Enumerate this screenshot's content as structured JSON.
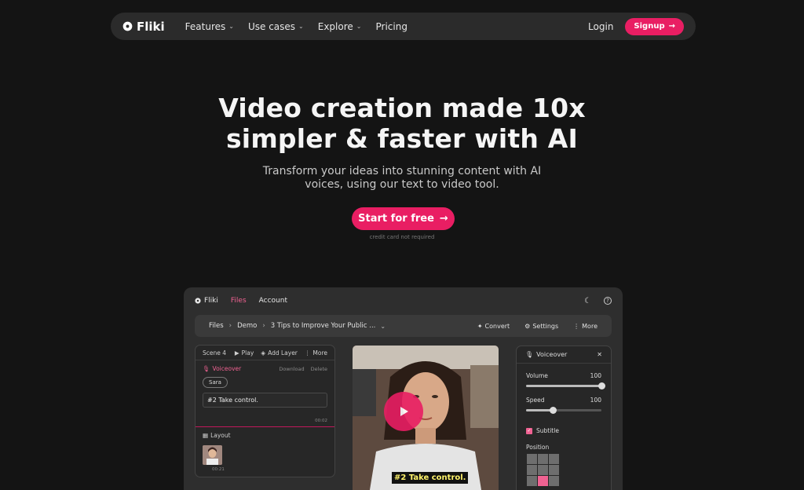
{
  "nav": {
    "brand": "Fliki",
    "items": [
      {
        "label": "Features",
        "has_menu": true
      },
      {
        "label": "Use cases",
        "has_menu": true
      },
      {
        "label": "Explore",
        "has_menu": true
      },
      {
        "label": "Pricing",
        "has_menu": false
      }
    ],
    "login": "Login",
    "signup": "Signup"
  },
  "hero": {
    "title_line1": "Video creation made 10x",
    "title_line2": "simpler & faster with AI",
    "subtitle_line1": "Transform your ideas into stunning content with AI",
    "subtitle_line2": "voices, using our text to video tool.",
    "cta": "Start for free",
    "cta_note": "credit card not required"
  },
  "app": {
    "brand": "Fliki",
    "tabs": [
      "Files",
      "Account"
    ],
    "active_tab": "Files",
    "breadcrumb": [
      "Files",
      "Demo",
      "3 Tips to Improve Your Public ..."
    ],
    "actions": {
      "convert": "Convert",
      "settings": "Settings",
      "more": "More"
    },
    "scene": {
      "title": "Scene 4",
      "play": "Play",
      "add_layer": "Add Layer",
      "more": "More",
      "voiceover_label": "Voiceover",
      "download": "Download",
      "delete": "Delete",
      "voice_name": "Sara",
      "text": "#2 Take control.",
      "duration": "00:02",
      "layout_label": "Layout",
      "layer_time": "00:21"
    },
    "video": {
      "caption": "#2 Take control."
    },
    "voiceover_panel": {
      "title": "Voiceover",
      "volume_label": "Volume",
      "volume_value": "100",
      "volume_level": 1.0,
      "speed_label": "Speed",
      "speed_value": "100",
      "speed_level": 0.35,
      "subtitle_label": "Subtitle",
      "subtitle_checked": true,
      "position_label": "Position",
      "position_selected": {
        "row": 2,
        "col": 1
      }
    }
  },
  "colors": {
    "accent": "#e91e63",
    "accent_light": "#f06292",
    "background": "#141414"
  }
}
